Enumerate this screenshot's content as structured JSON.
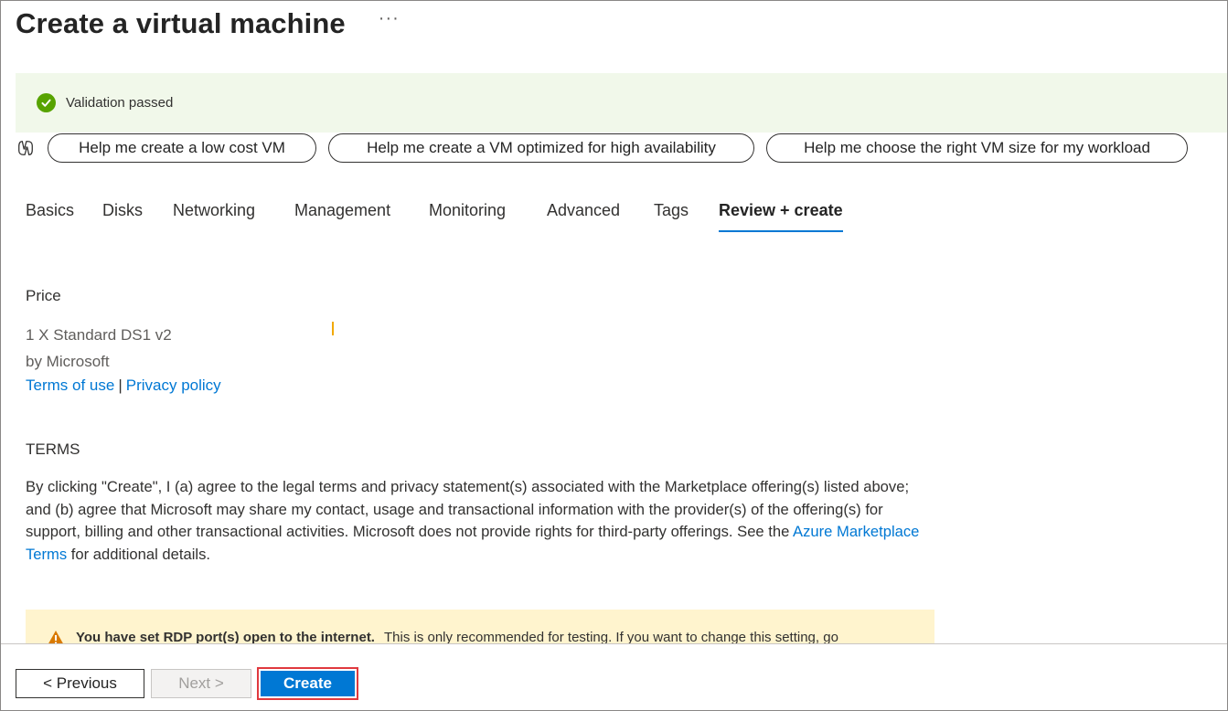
{
  "page": {
    "title": "Create a virtual machine",
    "more_label": "···"
  },
  "banner": {
    "status_text": "Validation passed",
    "color": "#57a300"
  },
  "copilot": {
    "icon": "copilot-icon",
    "suggestions": [
      "Help me create a low cost VM",
      "Help me create a VM optimized for high availability",
      "Help me choose the right VM size for my workload"
    ]
  },
  "tabs": [
    {
      "label": "Basics",
      "active": false
    },
    {
      "label": "Disks",
      "active": false
    },
    {
      "label": "Networking",
      "active": false
    },
    {
      "label": "Management",
      "active": false
    },
    {
      "label": "Monitoring",
      "active": false
    },
    {
      "label": "Advanced",
      "active": false
    },
    {
      "label": "Tags",
      "active": false
    },
    {
      "label": "Review + create",
      "active": true
    }
  ],
  "price": {
    "heading": "Price",
    "product": "1 X Standard DS1 v2",
    "publisher": "by Microsoft",
    "terms_link": "Terms of use",
    "separator": "|",
    "privacy_link": "Privacy policy"
  },
  "terms": {
    "heading": "TERMS",
    "text_before_link": "By clicking \"Create\", I (a) agree to the legal terms and privacy statement(s) associated with the Marketplace offering(s) listed above; and (b) agree that Microsoft may share my contact, usage and transactional information with the provider(s) of the offering(s) for support, billing and other transactional activities. Microsoft does not provide rights for third-party offerings. See the ",
    "link_text": "Azure Marketplace Terms",
    "text_after_link": " for additional details."
  },
  "warning": {
    "bold_text": "You have set RDP port(s) open to the internet.",
    "rest_text": "This is only recommended for testing.  If you want to change this setting, go",
    "color": "#fff4ce"
  },
  "footer": {
    "previous_label": "< Previous",
    "next_label": "Next >",
    "create_label": "Create",
    "accent": "#0078d4"
  }
}
